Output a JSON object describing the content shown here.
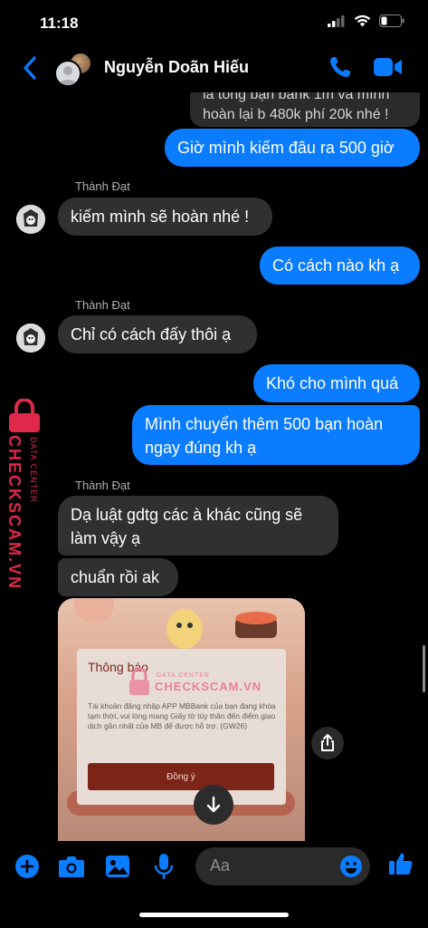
{
  "status": {
    "time": "11:18"
  },
  "header": {
    "contact_name": "Nguyễn Doãn Hiếu"
  },
  "messages": {
    "partial_top_line1": "là tổng bạn bank 1m và mình",
    "partial_top_line2": "hoàn lại b 480k phí 20k nhé !",
    "m1": "Giờ mình kiếm đâu ra 500 giờ",
    "sender1": "Thành Đạt",
    "m2": "kiếm mình sẽ hoàn nhé !",
    "m3": "Có cách nào kh ạ",
    "sender2": "Thành Đạt",
    "m4": "Chỉ có cách đấy thôi ạ",
    "m5": "Khó cho mình quá",
    "m6_line1": "Mình chuyển thêm 500 bạn hoàn",
    "m6_line2": "ngay đúng kh ạ",
    "sender3": "Thành Đạt",
    "m7_line1": "Dạ luật gdtg các à khác cũng sẽ",
    "m7_line2": "làm vậy ạ",
    "m8": "chuẩn rồi ak"
  },
  "image_dialog": {
    "title": "Thông báo",
    "body": "Tài khoản đăng nhập APP MBBank của bạn đang khóa tạm thời, vui lòng mang Giấy tờ tùy thân đến điểm giao dịch gần nhất của MB để được hỗ trợ. (GW26)",
    "button": "Đồng ý",
    "watermark_top": "DATA CENTER",
    "watermark_main": "CHECKSCAM.VN"
  },
  "side_watermark": {
    "small": "DATA CENTER",
    "main": "CHECKSCAM.VN"
  },
  "composer": {
    "placeholder": "Aa"
  },
  "colors": {
    "accent": "#0a7cff",
    "incoming": "#303030",
    "watermark": "#e0284a"
  },
  "icons": [
    "back-icon",
    "phone-icon",
    "video-icon",
    "plus-icon",
    "camera-icon",
    "gallery-icon",
    "mic-icon",
    "emoji-icon",
    "like-icon",
    "share-icon",
    "arrow-down-icon"
  ]
}
